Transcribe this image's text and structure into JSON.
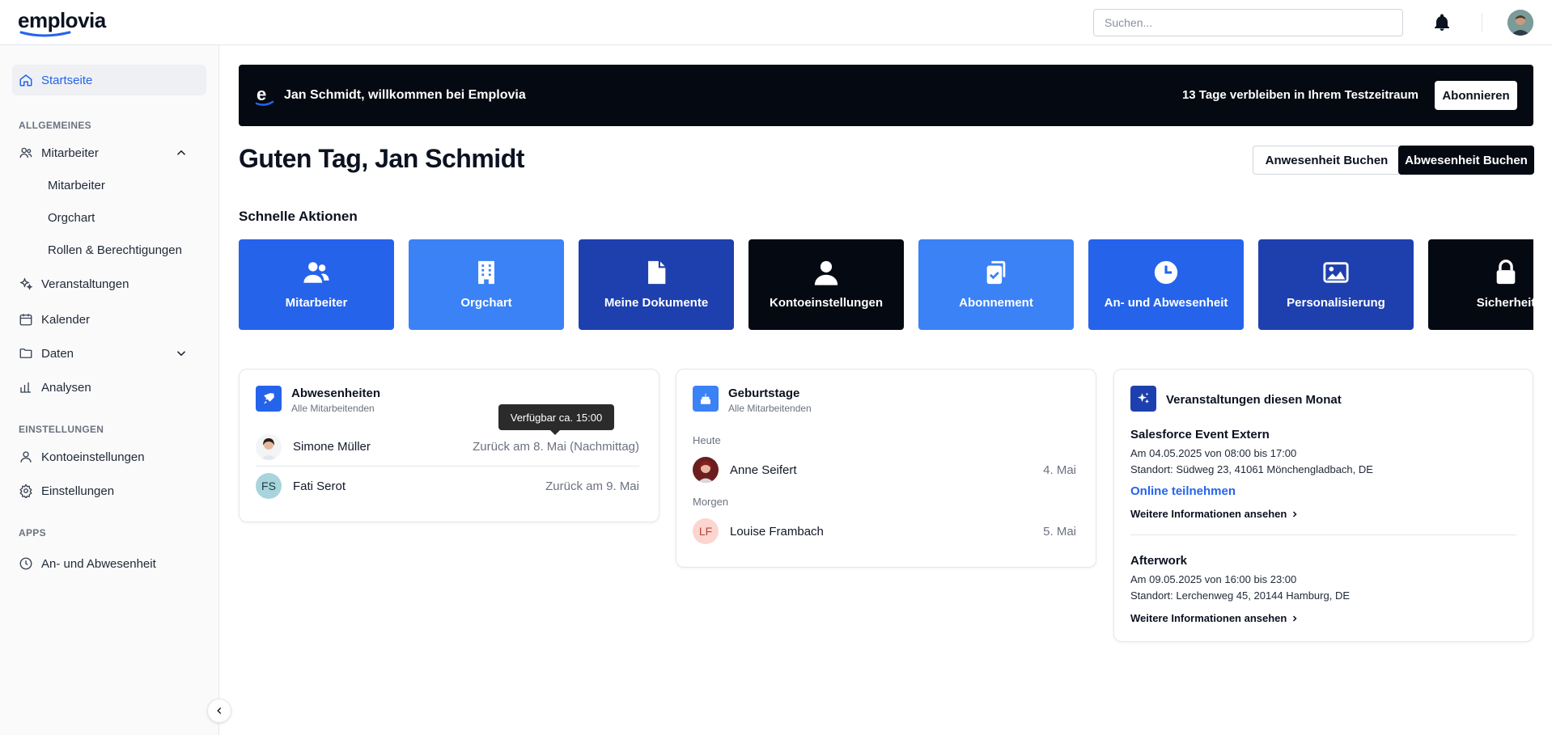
{
  "app": {
    "logo_text": "emplovia"
  },
  "search": {
    "placeholder": "Suchen..."
  },
  "sidebar": {
    "home": "Startseite",
    "section_general": "ALLGEMEINES",
    "employees_group": "Mitarbeiter",
    "employees_sub": [
      "Mitarbeiter",
      "Orgchart",
      "Rollen & Berechtigungen"
    ],
    "events": "Veranstaltungen",
    "calendar": "Kalender",
    "data": "Daten",
    "analytics": "Analysen",
    "section_settings": "EINSTELLUNGEN",
    "account_settings": "Kontoeinstellungen",
    "settings": "Einstellungen",
    "section_apps": "APPS",
    "attendance": "An- und Abwesenheit"
  },
  "banner": {
    "welcome": "Jan Schmidt, willkommen bei Emplovia",
    "trial": "13 Tage verbleiben in Ihrem Testzeitraum",
    "subscribe": "Abonnieren"
  },
  "main": {
    "greeting": "Guten Tag, Jan Schmidt",
    "btn_attendance": "Anwesenheit Buchen",
    "btn_absence": "Abwesenheit Buchen",
    "quick_actions_title": "Schnelle Aktionen"
  },
  "quick_actions": [
    {
      "label": "Mitarbeiter",
      "icon": "users-icon",
      "color": "#2563eb"
    },
    {
      "label": "Orgchart",
      "icon": "building-icon",
      "color": "#3b82f6"
    },
    {
      "label": "Meine Dokumente",
      "icon": "document-icon",
      "color": "#1e40af"
    },
    {
      "label": "Kontoeinstellungen",
      "icon": "user-icon",
      "color": "#050912"
    },
    {
      "label": "Abonnement",
      "icon": "subscription-icon",
      "color": "#3b82f6"
    },
    {
      "label": "An- und Abwesenheit",
      "icon": "clock-icon",
      "color": "#2563eb"
    },
    {
      "label": "Personalisierung",
      "icon": "image-icon",
      "color": "#1e40af"
    },
    {
      "label": "Sicherheit",
      "icon": "lock-icon",
      "color": "#050912"
    }
  ],
  "absences": {
    "title": "Abwesenheiten",
    "subtitle": "Alle Mitarbeitenden",
    "tooltip": "Verfügbar ca. 15:00",
    "rows": [
      {
        "name": "Simone Müller",
        "status": "Zurück am 8. Mai (Nachmittag)",
        "initials": ""
      },
      {
        "name": "Fati Serot",
        "status": "Zurück am 9. Mai",
        "initials": "FS"
      }
    ]
  },
  "birthdays": {
    "title": "Geburtstage",
    "subtitle": "Alle Mitarbeitenden",
    "today_label": "Heute",
    "tomorrow_label": "Morgen",
    "today": {
      "name": "Anne Seifert",
      "date": "4. Mai"
    },
    "tomorrow": {
      "name": "Louise Frambach",
      "date": "5. Mai",
      "initials": "LF"
    }
  },
  "events": {
    "title": "Veranstaltungen diesen Monat",
    "items": [
      {
        "title": "Salesforce Event Extern",
        "time": "Am 04.05.2025 von 08:00 bis 17:00",
        "location": "Standort: Südweg 23, 41061 Mönchengladbach, DE",
        "online": "Online teilnehmen",
        "more": "Weitere Informationen ansehen"
      },
      {
        "title": "Afterwork",
        "time": "Am 09.05.2025 von 16:00 bis 23:00",
        "location": "Standort: Lerchenweg 45, 20144 Hamburg, DE",
        "more": "Weitere Informationen ansehen"
      }
    ]
  }
}
